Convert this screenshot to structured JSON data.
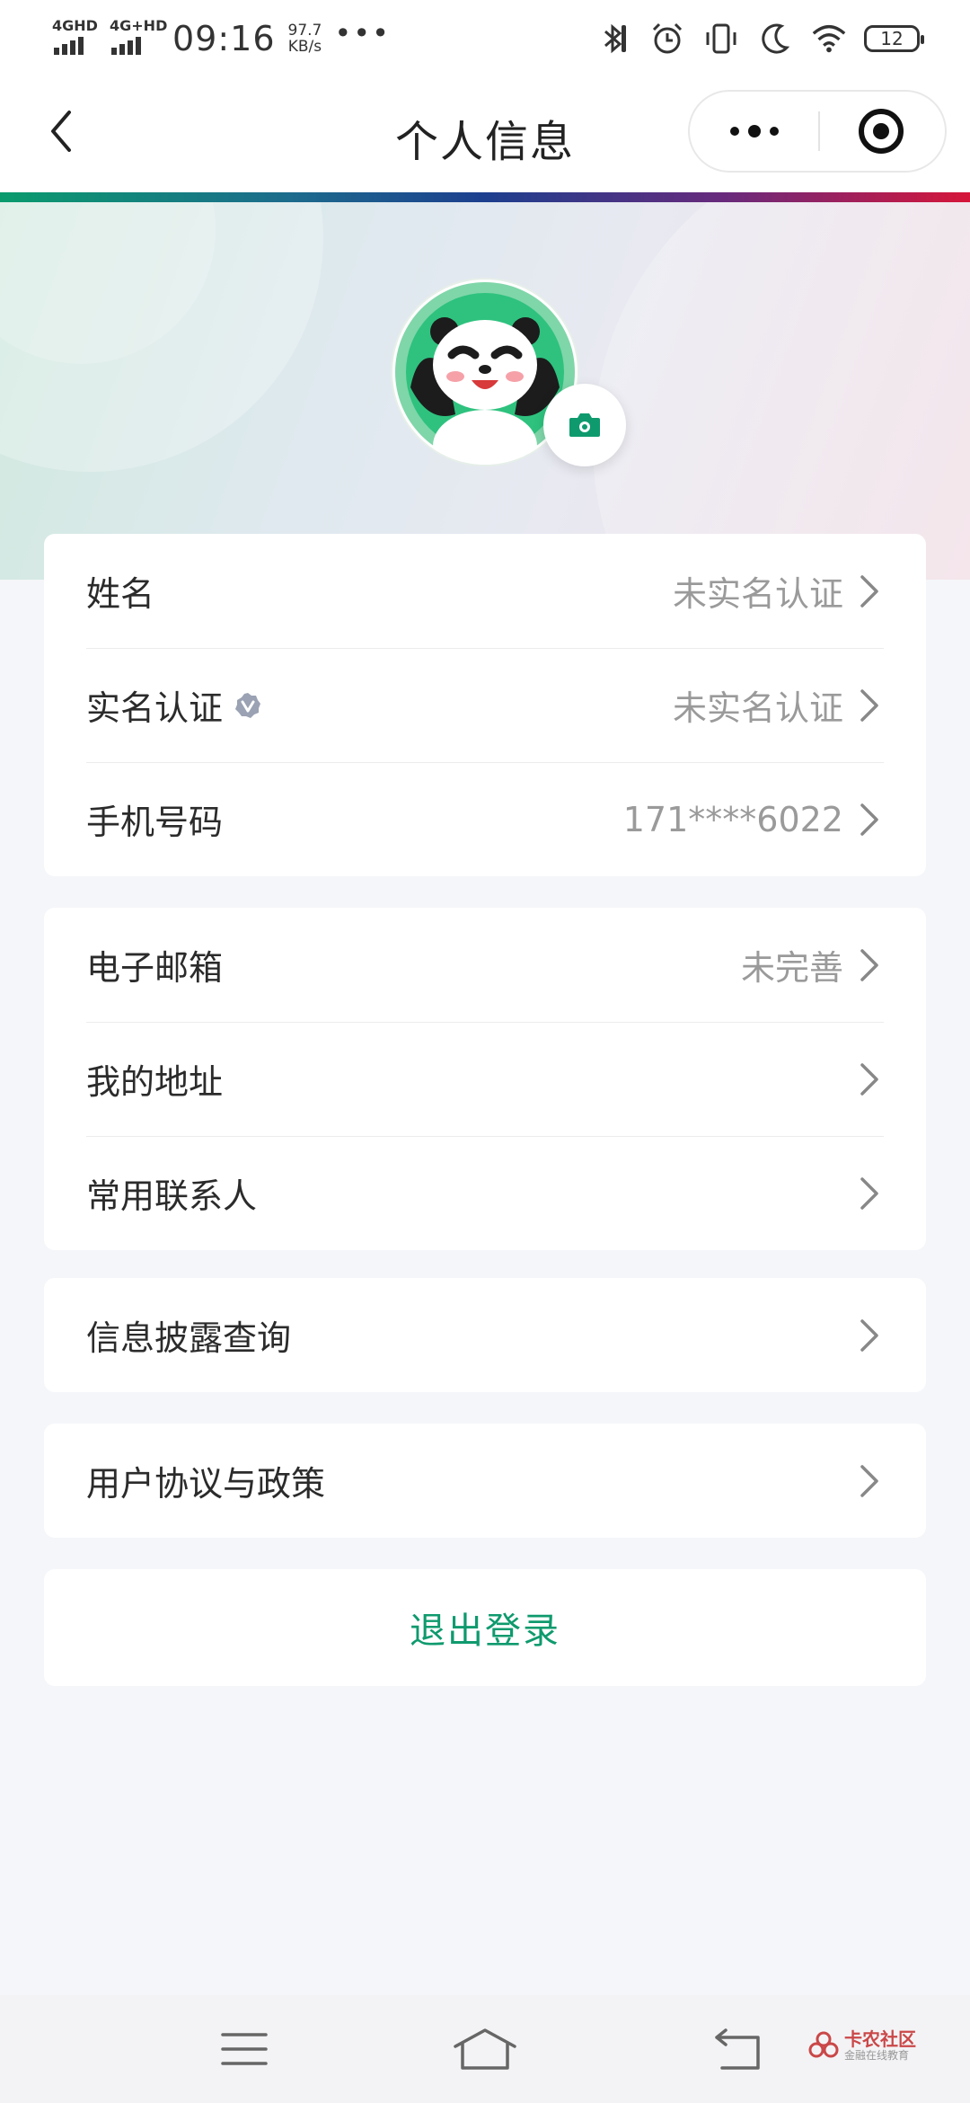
{
  "status_bar": {
    "signal1": "4GHD",
    "signal2": "4G+HD",
    "time": "09:16",
    "speed_value": "97.7",
    "speed_unit": "KB/s",
    "more": "•••",
    "battery": "12"
  },
  "nav": {
    "title": "个人信息",
    "back_icon": "chevron-left-icon",
    "more_icon": "more-dots-icon",
    "close_icon": "target-icon"
  },
  "profile": {
    "avatar_icon": "panda-avatar",
    "camera_icon": "camera-icon",
    "accent": "#0f9a6e"
  },
  "groups": [
    {
      "rows": [
        {
          "label": "姓名",
          "value": "未实名认证"
        },
        {
          "label": "实名认证",
          "value": "未实名认证",
          "badge": "verified-badge-icon"
        },
        {
          "label": "手机号码",
          "value": "171****6022"
        }
      ]
    },
    {
      "rows": [
        {
          "label": "电子邮箱",
          "value": "未完善"
        },
        {
          "label": "我的地址",
          "value": ""
        },
        {
          "label": "常用联系人",
          "value": ""
        }
      ]
    },
    {
      "rows": [
        {
          "label": "信息披露查询",
          "value": ""
        }
      ]
    },
    {
      "rows": [
        {
          "label": "用户协议与政策",
          "value": ""
        }
      ]
    }
  ],
  "logout": "退出登录",
  "system_nav": {
    "menu_icon": "menu-icon",
    "home_icon": "home-icon",
    "back_icon": "back-icon"
  },
  "watermark": {
    "brand": "卡农社区",
    "sub": "金融在线教育"
  }
}
